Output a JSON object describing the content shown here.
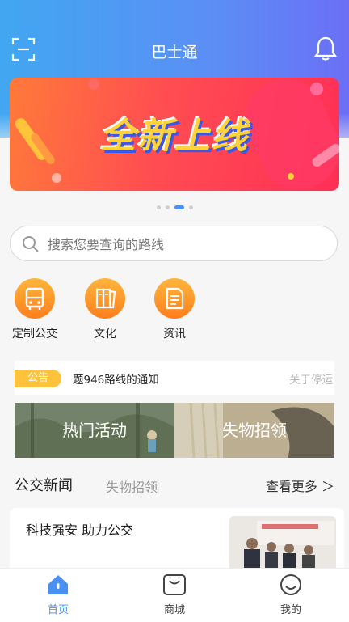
{
  "header": {
    "title": "巴士通"
  },
  "banner": {
    "headline": "全新上线",
    "page_count": 4,
    "active_page": 3
  },
  "search": {
    "placeholder": "搜索您要查询的路线"
  },
  "quick_links": [
    {
      "label": "定制公交",
      "icon": "bus-icon"
    },
    {
      "label": "文化",
      "icon": "book-icon"
    },
    {
      "label": "资讯",
      "icon": "document-icon"
    }
  ],
  "notice": {
    "tag": "公告",
    "text": "题946路线的通知",
    "next_text": "关于停运"
  },
  "tiles": [
    {
      "label": "热门活动"
    },
    {
      "label": "失物招领"
    }
  ],
  "news": {
    "tabs": [
      "公交新闻",
      "失物招领"
    ],
    "more": "查看更多 ＞",
    "items": [
      {
        "title": "科技强安  助力公交"
      }
    ]
  },
  "bottom_nav": [
    {
      "label": "首页",
      "active": true
    },
    {
      "label": "商城",
      "active": false
    },
    {
      "label": "我的",
      "active": false
    }
  ],
  "colors": {
    "accent": "#4a8ff2",
    "orange": "#ff8a20",
    "notice_tag": "#ffc23b"
  }
}
